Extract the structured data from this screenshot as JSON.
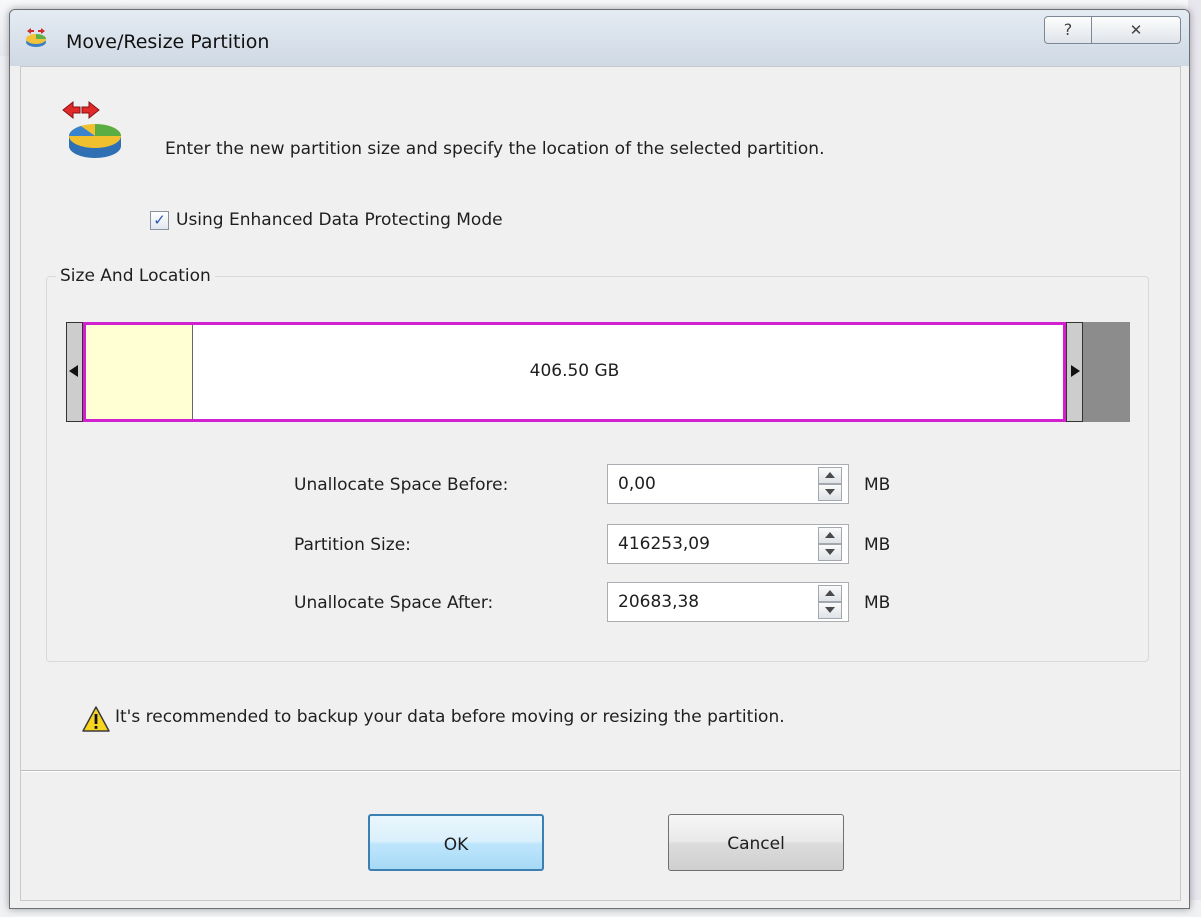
{
  "window": {
    "title": "Move/Resize Partition",
    "help_glyph": "?",
    "close_glyph": "✕"
  },
  "header": {
    "instruction": "Enter the new partition size and specify the location of the selected partition."
  },
  "options": {
    "enhanced_mode_label": "Using Enhanced Data Protecting Mode",
    "enhanced_mode_checked": true
  },
  "size_and_location": {
    "legend": "Size And Location",
    "partition_label": "406.50 GB",
    "partition_border_color": "#d020d0",
    "used_fill_color": "#ffffd3",
    "unallocated_color": "#8c8c8c",
    "fields": [
      {
        "label": "Unallocate Space Before:",
        "value": "0,00",
        "unit": "MB"
      },
      {
        "label": "Partition Size:",
        "value": "416253,09",
        "unit": "MB"
      },
      {
        "label": "Unallocate Space After:",
        "value": "20683,38",
        "unit": "MB"
      }
    ]
  },
  "warning": {
    "text": "It's recommended to backup your data before moving or resizing the partition.",
    "icon": "warning-icon"
  },
  "buttons": {
    "ok": "OK",
    "cancel": "Cancel"
  }
}
